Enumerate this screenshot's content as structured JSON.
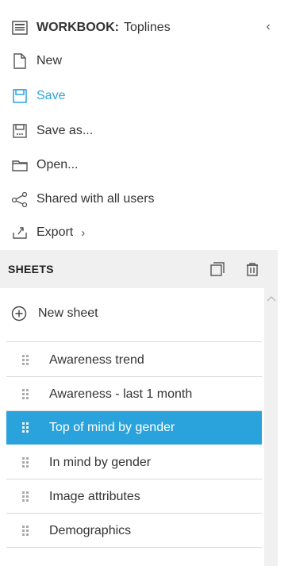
{
  "workbook": {
    "title_prefix": "WORKBOOK:",
    "name": "Toplines"
  },
  "menu": {
    "new": "New",
    "save": "Save",
    "save_as": "Save as...",
    "open": "Open...",
    "shared": "Shared with all users",
    "export": "Export"
  },
  "sheets": {
    "header": "SHEETS",
    "new_sheet": "New sheet",
    "items": [
      {
        "label": "Awareness trend"
      },
      {
        "label": "Awareness - last 1 month"
      },
      {
        "label": "Top of mind by gender"
      },
      {
        "label": "In mind by gender"
      },
      {
        "label": "Image attributes"
      },
      {
        "label": "Demographics"
      }
    ],
    "active_item": "Top of mind by gender"
  },
  "colors": {
    "accent": "#2aa3dc",
    "header_bg": "#f0f0f0",
    "divider": "#d9d9d9"
  },
  "icons": [
    "workbook-icon",
    "collapse-chevron-icon",
    "new-file-icon",
    "save-icon",
    "save-as-icon",
    "folder-open-icon",
    "share-icon",
    "export-icon",
    "chevron-right-icon",
    "duplicate-icon",
    "trash-icon",
    "plus-circle-icon",
    "drag-handle-icon",
    "scroll-up-icon"
  ]
}
